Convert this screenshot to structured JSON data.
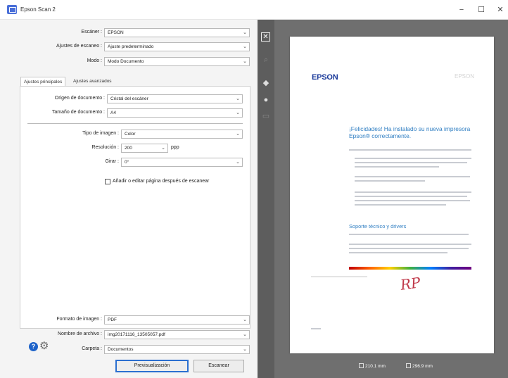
{
  "window": {
    "title": "Epson Scan 2",
    "minimize": "−",
    "maximize": "☐",
    "close": "✕"
  },
  "settings": {
    "scanner": {
      "label": "Escáner :",
      "value": "EPSON"
    },
    "scan_settings": {
      "label": "Ajustes de escaneo :",
      "value": "Ajuste predeterminado"
    },
    "mode": {
      "label": "Modo :",
      "value": "Modo Documento"
    }
  },
  "tabs": {
    "main": "Ajustes principales",
    "advanced": "Ajustes avanzados"
  },
  "main_tab": {
    "document_source": {
      "label": "Origen de documento :",
      "value": "Cristal del escáner"
    },
    "document_size": {
      "label": "Tamaño de documento :",
      "value": "A4"
    },
    "image_type": {
      "label": "Tipo de imagen :",
      "value": "Color"
    },
    "resolution": {
      "label": "Resolución :",
      "value": "200",
      "unit": "ppp"
    },
    "rotate": {
      "label": "Girar :",
      "value": "0°"
    },
    "add_edit_pages": {
      "label": "Añadir o editar página después de escanear",
      "checked": false
    }
  },
  "output": {
    "image_format": {
      "label": "Formato de imagen :",
      "value": "PDF"
    },
    "file_name": {
      "label": "Nombre de archivo :",
      "value": "img20171116_13505057.pdf"
    },
    "folder": {
      "label": "Carpeta :",
      "value": "Documentos"
    }
  },
  "buttons": {
    "preview": "Previsualización",
    "scan": "Escanear"
  },
  "preview": {
    "logo": "EPSON",
    "logo_faint": "EPSON",
    "heading": "¡Felicidades! Ha instalado su nueva impresora Epson® correctamente.",
    "subheading": "Soporte técnico y drivers",
    "width": "210.1 mm",
    "height": "296.9 mm"
  },
  "colors": {
    "accent": "#2b6fd0",
    "preview_bg": "#6f6f6f",
    "epson_blue": "#1b3a9a",
    "heading_blue": "#2f7ec2"
  },
  "icons": [
    "app-icon",
    "chevron-down-icon",
    "help-icon",
    "gear-icon",
    "close-icon",
    "zoom-icon",
    "rotate-icon",
    "settings-icon",
    "crop-icon",
    "width-icon",
    "height-icon"
  ]
}
